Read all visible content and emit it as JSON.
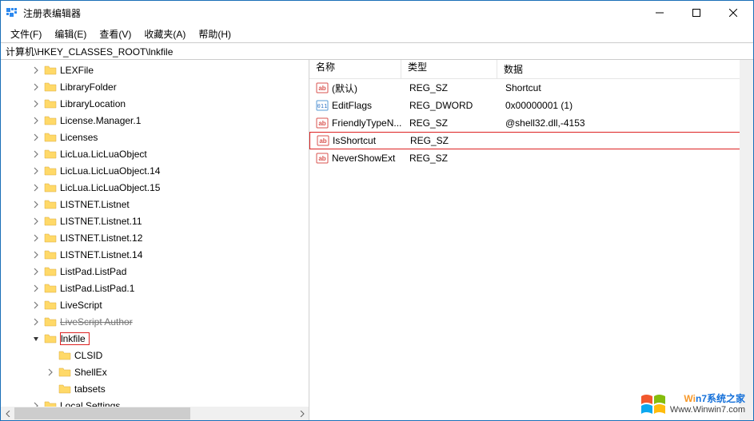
{
  "titlebar": {
    "title": "注册表编辑器"
  },
  "menu": {
    "file": "文件(F)",
    "edit": "编辑(E)",
    "view": "查看(V)",
    "fav": "收藏夹(A)",
    "help": "帮助(H)"
  },
  "address": "计算机\\HKEY_CLASSES_ROOT\\lnkfile",
  "tree": {
    "items": [
      {
        "label": "LEXFile",
        "indent": 2,
        "exp": ">"
      },
      {
        "label": "LibraryFolder",
        "indent": 2,
        "exp": ">"
      },
      {
        "label": "LibraryLocation",
        "indent": 2,
        "exp": ">"
      },
      {
        "label": "License.Manager.1",
        "indent": 2,
        "exp": ">"
      },
      {
        "label": "Licenses",
        "indent": 2,
        "exp": ">"
      },
      {
        "label": "LicLua.LicLuaObject",
        "indent": 2,
        "exp": ">"
      },
      {
        "label": "LicLua.LicLuaObject.14",
        "indent": 2,
        "exp": ">"
      },
      {
        "label": "LicLua.LicLuaObject.15",
        "indent": 2,
        "exp": ">"
      },
      {
        "label": "LISTNET.Listnet",
        "indent": 2,
        "exp": ">"
      },
      {
        "label": "LISTNET.Listnet.11",
        "indent": 2,
        "exp": ">"
      },
      {
        "label": "LISTNET.Listnet.12",
        "indent": 2,
        "exp": ">"
      },
      {
        "label": "LISTNET.Listnet.14",
        "indent": 2,
        "exp": ">"
      },
      {
        "label": "ListPad.ListPad",
        "indent": 2,
        "exp": ">"
      },
      {
        "label": "ListPad.ListPad.1",
        "indent": 2,
        "exp": ">"
      },
      {
        "label": "LiveScript",
        "indent": 2,
        "exp": ">"
      },
      {
        "label": "LiveScript Author",
        "indent": 2,
        "exp": ">",
        "strike": true
      },
      {
        "label": "lnkfile",
        "indent": 2,
        "exp": "v",
        "selected": true
      },
      {
        "label": "CLSID",
        "indent": 3,
        "exp": ""
      },
      {
        "label": "ShellEx",
        "indent": 3,
        "exp": ">"
      },
      {
        "label": "tabsets",
        "indent": 3,
        "exp": ""
      },
      {
        "label": "Local Settings",
        "indent": 2,
        "exp": ">"
      }
    ]
  },
  "columns": {
    "name": "名称",
    "type": "类型",
    "data": "数据"
  },
  "values": [
    {
      "icon": "str",
      "name": "(默认)",
      "type": "REG_SZ",
      "data": "Shortcut"
    },
    {
      "icon": "bin",
      "name": "EditFlags",
      "type": "REG_DWORD",
      "data": "0x00000001 (1)"
    },
    {
      "icon": "str",
      "name": "FriendlyTypeN...",
      "type": "REG_SZ",
      "data": "@shell32.dll,-4153"
    },
    {
      "icon": "str",
      "name": "IsShortcut",
      "type": "REG_SZ",
      "data": "",
      "highlight": true
    },
    {
      "icon": "str",
      "name": "NeverShowExt",
      "type": "REG_SZ",
      "data": ""
    }
  ],
  "watermark": {
    "line1a": "Wi",
    "line1b": "n7系统之家",
    "line2": "Www.Winwin7.com"
  }
}
